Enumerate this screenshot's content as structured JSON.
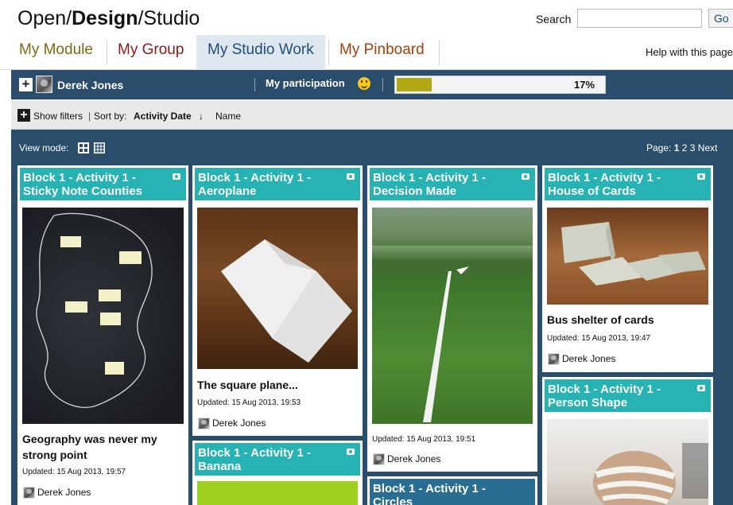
{
  "header": {
    "brand_open": "Open/",
    "brand_design": "Design",
    "brand_studio": "/Studio",
    "search_label": "Search",
    "search_value": "",
    "go_label": "Go"
  },
  "tabs": [
    {
      "label": "My Module",
      "color": "#7a6a12"
    },
    {
      "label": "My Group",
      "color": "#8b1a1a"
    },
    {
      "label": "My Studio Work",
      "color": "#1f4e78"
    },
    {
      "label": "My Pinboard",
      "color": "#a0420b"
    }
  ],
  "help_link": "Help with this page",
  "participation": {
    "user": "Derek Jones",
    "label": "My participation",
    "progress_percent": 17,
    "progress_text": "17%"
  },
  "filters": {
    "show_filters": "Show filters",
    "sort_by": "Sort by:",
    "sort_activity": "Activity Date",
    "sort_arrow": "↓",
    "sort_name": "Name"
  },
  "view": {
    "view_mode": "View mode:",
    "page_label": "Page:",
    "pages": [
      "1",
      "2",
      "3"
    ],
    "next": "Next"
  },
  "cards": [
    {
      "title": "Block 1 - Activity 1 - Sticky Note Counties",
      "caption": "Geography was never my strong point",
      "updated": "Updated: 15 Aug 2013, 19:57",
      "author": "Derek Jones"
    },
    {
      "title": "Block 1 - Activity 1 - Aeroplane",
      "caption": "The square plane...",
      "updated": "Updated: 15 Aug 2013, 19:53",
      "author": "Derek Jones"
    },
    {
      "title": "Block 1 - Activity 1 - Decision Made",
      "caption": "",
      "updated": "Updated: 15 Aug 2013, 19:51",
      "author": "Derek Jones"
    },
    {
      "title": "Block 1 - Activity 1 - House of Cards",
      "caption": "Bus shelter of cards",
      "updated": "Updated: 15 Aug 2013, 19:47",
      "author": "Derek Jones"
    },
    {
      "title": "Block 1 - Activity 1 - Person Shape",
      "caption": "",
      "updated": "",
      "author": ""
    },
    {
      "title": "Block 1 - Activity 1 - Banana",
      "caption": "",
      "updated": "",
      "author": ""
    },
    {
      "title": "Block 1 - Activity 1 - Circles",
      "caption": "",
      "updated": "",
      "author": ""
    }
  ],
  "colors": {
    "teal": "#27b3b4",
    "navy": "#2a4d6b",
    "progress": "#b1a912"
  }
}
